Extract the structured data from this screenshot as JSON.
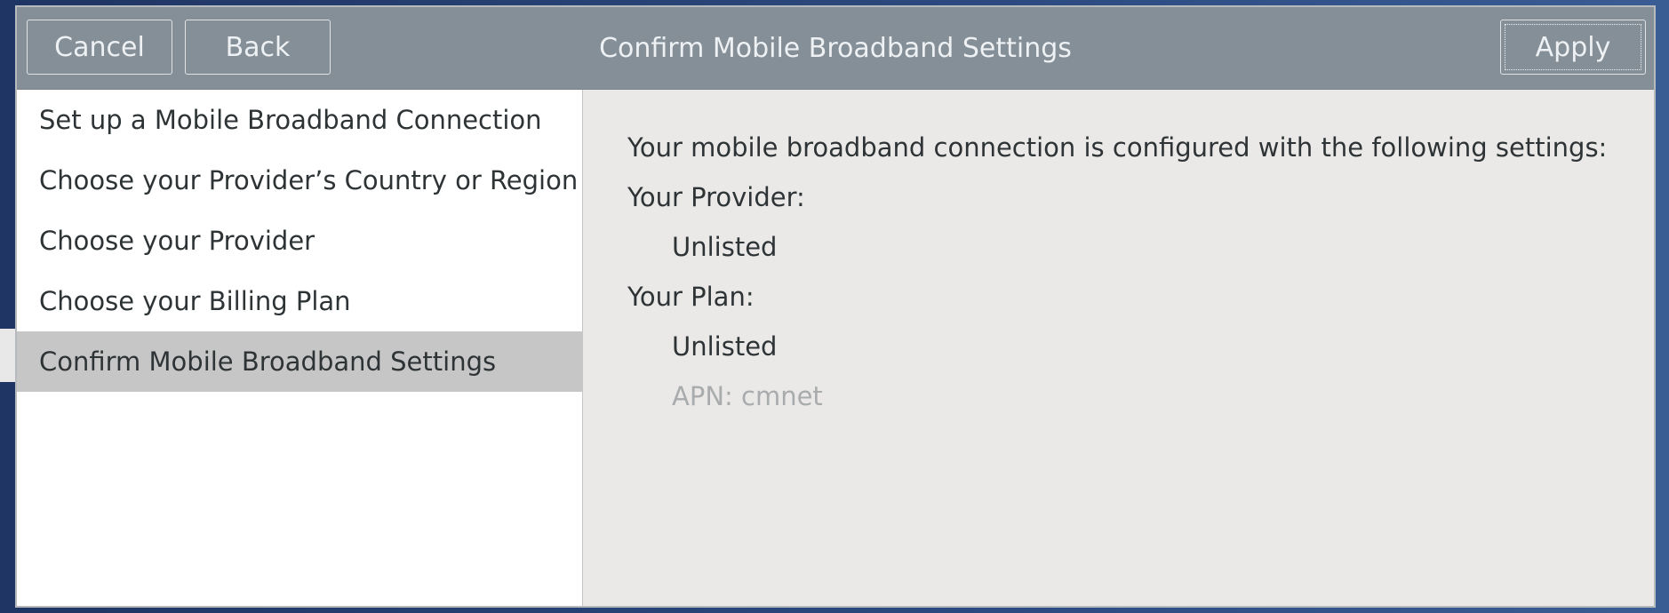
{
  "window": {
    "title": "Confirm Mobile Broadband Settings"
  },
  "headerbar": {
    "cancel_label": "Cancel",
    "back_label": "Back",
    "apply_label": "Apply"
  },
  "sidebar": {
    "items": [
      {
        "label": "Set up a Mobile Broadband Connection"
      },
      {
        "label": "Choose your Provider’s Country or Region"
      },
      {
        "label": "Choose your Provider"
      },
      {
        "label": "Choose your Billing Plan"
      },
      {
        "label": "Confirm Mobile Broadband Settings"
      }
    ],
    "active_index": 4
  },
  "summary": {
    "intro": "Your mobile broadband connection is configured with the following settings:",
    "provider_heading": "Your Provider:",
    "provider_value": "Unlisted",
    "plan_heading": "Your Plan:",
    "plan_value": "Unlisted",
    "apn": "APN: cmnet"
  },
  "colors": {
    "headerbar": "#858f97",
    "selected_row": "#c6c6c6",
    "content_bg": "#ebe9e8",
    "dim_text": "#a9acad"
  }
}
